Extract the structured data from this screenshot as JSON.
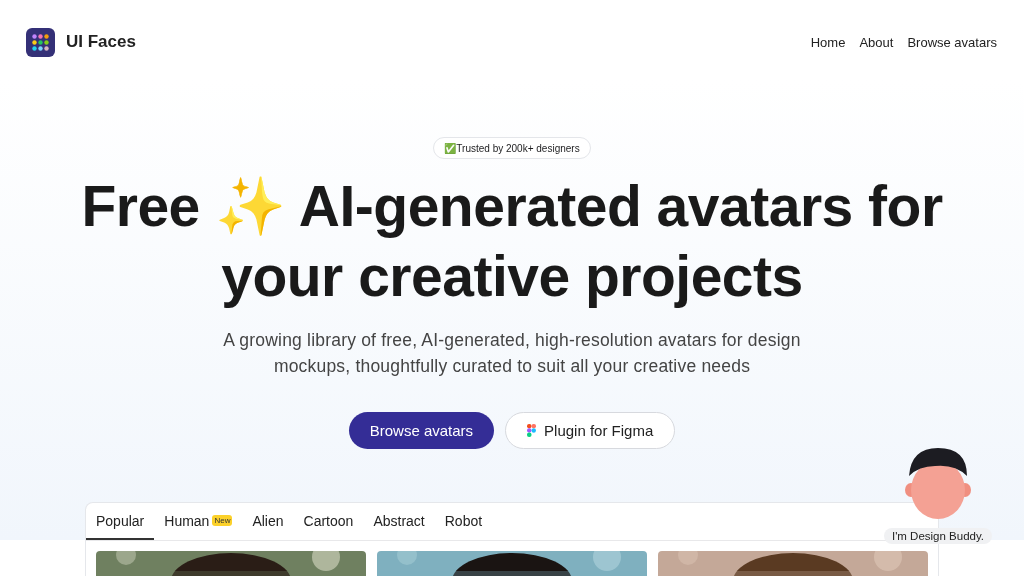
{
  "header": {
    "brand": "UI Faces",
    "nav": [
      "Home",
      "About",
      "Browse avatars"
    ]
  },
  "hero": {
    "badge": "✅Trusted by 200k+ designers",
    "title_lines": [
      "Free ✨ AI-generated avatars for",
      "your creative projects"
    ],
    "subtitle": "A growing library of free, AI-generated, high-resolution avatars for design mockups, thoughtfully curated to suit all your creative needs",
    "buttons": [
      {
        "label": "Browse avatars",
        "kind": "primary"
      },
      {
        "label": "Plugin for Figma",
        "kind": "figma"
      }
    ]
  },
  "gallery": {
    "tabs": [
      {
        "label": "Popular",
        "selected": true
      },
      {
        "label": "Human",
        "selected": false,
        "badge": "New"
      },
      {
        "label": "Alien",
        "selected": false
      },
      {
        "label": "Cartoon",
        "selected": false
      },
      {
        "label": "Abstract",
        "selected": false
      },
      {
        "label": "Robot",
        "selected": false
      }
    ]
  },
  "buddy": {
    "caption": "I'm Design Buddy."
  }
}
